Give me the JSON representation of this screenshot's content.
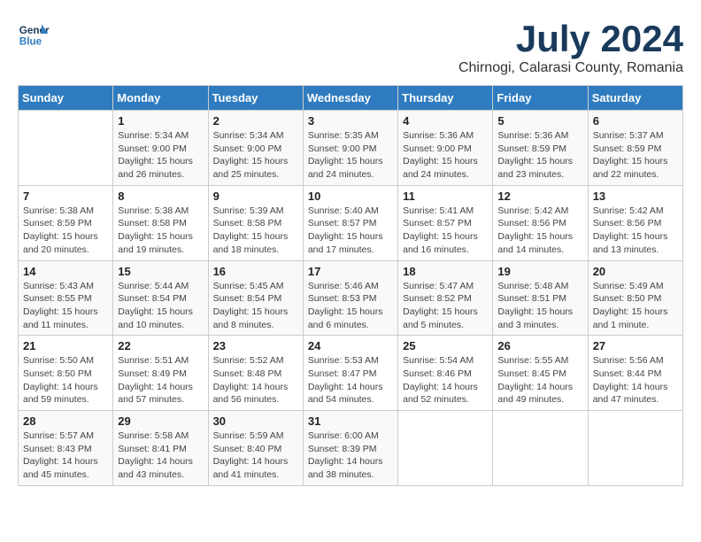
{
  "logo": {
    "line1": "General",
    "line2": "Blue"
  },
  "title": "July 2024",
  "subtitle": "Chirnogi, Calarasi County, Romania",
  "days_header": [
    "Sunday",
    "Monday",
    "Tuesday",
    "Wednesday",
    "Thursday",
    "Friday",
    "Saturday"
  ],
  "weeks": [
    [
      {
        "day": "",
        "info": ""
      },
      {
        "day": "1",
        "info": "Sunrise: 5:34 AM\nSunset: 9:00 PM\nDaylight: 15 hours\nand 26 minutes."
      },
      {
        "day": "2",
        "info": "Sunrise: 5:34 AM\nSunset: 9:00 PM\nDaylight: 15 hours\nand 25 minutes."
      },
      {
        "day": "3",
        "info": "Sunrise: 5:35 AM\nSunset: 9:00 PM\nDaylight: 15 hours\nand 24 minutes."
      },
      {
        "day": "4",
        "info": "Sunrise: 5:36 AM\nSunset: 9:00 PM\nDaylight: 15 hours\nand 24 minutes."
      },
      {
        "day": "5",
        "info": "Sunrise: 5:36 AM\nSunset: 8:59 PM\nDaylight: 15 hours\nand 23 minutes."
      },
      {
        "day": "6",
        "info": "Sunrise: 5:37 AM\nSunset: 8:59 PM\nDaylight: 15 hours\nand 22 minutes."
      }
    ],
    [
      {
        "day": "7",
        "info": "Sunrise: 5:38 AM\nSunset: 8:59 PM\nDaylight: 15 hours\nand 20 minutes."
      },
      {
        "day": "8",
        "info": "Sunrise: 5:38 AM\nSunset: 8:58 PM\nDaylight: 15 hours\nand 19 minutes."
      },
      {
        "day": "9",
        "info": "Sunrise: 5:39 AM\nSunset: 8:58 PM\nDaylight: 15 hours\nand 18 minutes."
      },
      {
        "day": "10",
        "info": "Sunrise: 5:40 AM\nSunset: 8:57 PM\nDaylight: 15 hours\nand 17 minutes."
      },
      {
        "day": "11",
        "info": "Sunrise: 5:41 AM\nSunset: 8:57 PM\nDaylight: 15 hours\nand 16 minutes."
      },
      {
        "day": "12",
        "info": "Sunrise: 5:42 AM\nSunset: 8:56 PM\nDaylight: 15 hours\nand 14 minutes."
      },
      {
        "day": "13",
        "info": "Sunrise: 5:42 AM\nSunset: 8:56 PM\nDaylight: 15 hours\nand 13 minutes."
      }
    ],
    [
      {
        "day": "14",
        "info": "Sunrise: 5:43 AM\nSunset: 8:55 PM\nDaylight: 15 hours\nand 11 minutes."
      },
      {
        "day": "15",
        "info": "Sunrise: 5:44 AM\nSunset: 8:54 PM\nDaylight: 15 hours\nand 10 minutes."
      },
      {
        "day": "16",
        "info": "Sunrise: 5:45 AM\nSunset: 8:54 PM\nDaylight: 15 hours\nand 8 minutes."
      },
      {
        "day": "17",
        "info": "Sunrise: 5:46 AM\nSunset: 8:53 PM\nDaylight: 15 hours\nand 6 minutes."
      },
      {
        "day": "18",
        "info": "Sunrise: 5:47 AM\nSunset: 8:52 PM\nDaylight: 15 hours\nand 5 minutes."
      },
      {
        "day": "19",
        "info": "Sunrise: 5:48 AM\nSunset: 8:51 PM\nDaylight: 15 hours\nand 3 minutes."
      },
      {
        "day": "20",
        "info": "Sunrise: 5:49 AM\nSunset: 8:50 PM\nDaylight: 15 hours\nand 1 minute."
      }
    ],
    [
      {
        "day": "21",
        "info": "Sunrise: 5:50 AM\nSunset: 8:50 PM\nDaylight: 14 hours\nand 59 minutes."
      },
      {
        "day": "22",
        "info": "Sunrise: 5:51 AM\nSunset: 8:49 PM\nDaylight: 14 hours\nand 57 minutes."
      },
      {
        "day": "23",
        "info": "Sunrise: 5:52 AM\nSunset: 8:48 PM\nDaylight: 14 hours\nand 56 minutes."
      },
      {
        "day": "24",
        "info": "Sunrise: 5:53 AM\nSunset: 8:47 PM\nDaylight: 14 hours\nand 54 minutes."
      },
      {
        "day": "25",
        "info": "Sunrise: 5:54 AM\nSunset: 8:46 PM\nDaylight: 14 hours\nand 52 minutes."
      },
      {
        "day": "26",
        "info": "Sunrise: 5:55 AM\nSunset: 8:45 PM\nDaylight: 14 hours\nand 49 minutes."
      },
      {
        "day": "27",
        "info": "Sunrise: 5:56 AM\nSunset: 8:44 PM\nDaylight: 14 hours\nand 47 minutes."
      }
    ],
    [
      {
        "day": "28",
        "info": "Sunrise: 5:57 AM\nSunset: 8:43 PM\nDaylight: 14 hours\nand 45 minutes."
      },
      {
        "day": "29",
        "info": "Sunrise: 5:58 AM\nSunset: 8:41 PM\nDaylight: 14 hours\nand 43 minutes."
      },
      {
        "day": "30",
        "info": "Sunrise: 5:59 AM\nSunset: 8:40 PM\nDaylight: 14 hours\nand 41 minutes."
      },
      {
        "day": "31",
        "info": "Sunrise: 6:00 AM\nSunset: 8:39 PM\nDaylight: 14 hours\nand 38 minutes."
      },
      {
        "day": "",
        "info": ""
      },
      {
        "day": "",
        "info": ""
      },
      {
        "day": "",
        "info": ""
      }
    ]
  ]
}
